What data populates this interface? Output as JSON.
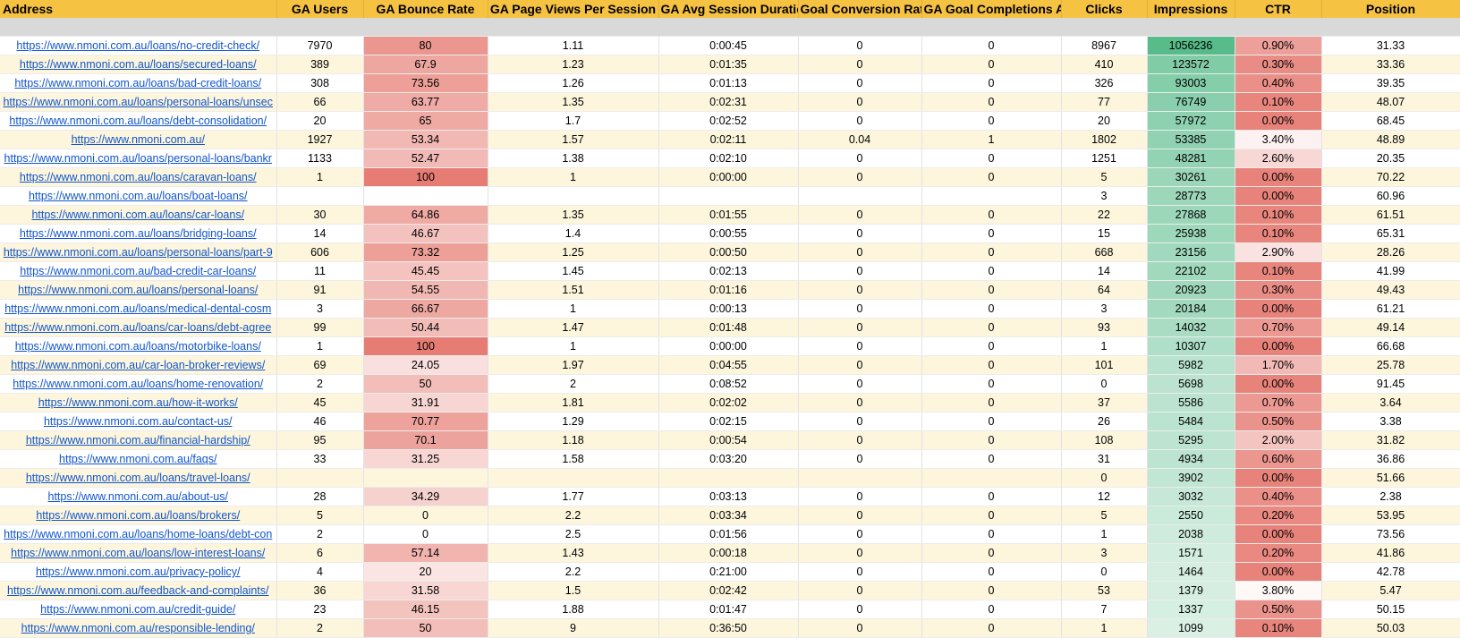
{
  "headers": [
    "Address",
    "GA Users",
    "GA Bounce Rate",
    "GA Page Views Per Session",
    "GA Avg Session Duration",
    "Goal Conversion Rate",
    "GA Goal Completions All",
    "Clicks",
    "Impressions",
    "CTR",
    "Position"
  ],
  "rows": [
    [
      "https://www.nmoni.com.au/loans/no-credit-check/",
      "7970",
      "80",
      "1.11",
      "0:00:45",
      "0",
      "0",
      "8967",
      "1056236",
      "0.90%",
      "31.33"
    ],
    [
      "https://www.nmoni.com.au/loans/secured-loans/",
      "389",
      "67.9",
      "1.23",
      "0:01:35",
      "0",
      "0",
      "410",
      "123572",
      "0.30%",
      "33.36"
    ],
    [
      "https://www.nmoni.com.au/loans/bad-credit-loans/",
      "308",
      "73.56",
      "1.26",
      "0:01:13",
      "0",
      "0",
      "326",
      "93003",
      "0.40%",
      "39.35"
    ],
    [
      "https://www.nmoni.com.au/loans/personal-loans/unsec",
      "66",
      "63.77",
      "1.35",
      "0:02:31",
      "0",
      "0",
      "77",
      "76749",
      "0.10%",
      "48.07"
    ],
    [
      "https://www.nmoni.com.au/loans/debt-consolidation/",
      "20",
      "65",
      "1.7",
      "0:02:52",
      "0",
      "0",
      "20",
      "57972",
      "0.00%",
      "68.45"
    ],
    [
      "https://www.nmoni.com.au/",
      "1927",
      "53.34",
      "1.57",
      "0:02:11",
      "0.04",
      "1",
      "1802",
      "53385",
      "3.40%",
      "48.89"
    ],
    [
      "https://www.nmoni.com.au/loans/personal-loans/bankr",
      "1133",
      "52.47",
      "1.38",
      "0:02:10",
      "0",
      "0",
      "1251",
      "48281",
      "2.60%",
      "20.35"
    ],
    [
      "https://www.nmoni.com.au/loans/caravan-loans/",
      "1",
      "100",
      "1",
      "0:00:00",
      "0",
      "0",
      "5",
      "30261",
      "0.00%",
      "70.22"
    ],
    [
      "https://www.nmoni.com.au/loans/boat-loans/",
      "",
      "",
      "",
      "",
      "",
      "",
      "3",
      "28773",
      "0.00%",
      "60.96"
    ],
    [
      "https://www.nmoni.com.au/loans/car-loans/",
      "30",
      "64.86",
      "1.35",
      "0:01:55",
      "0",
      "0",
      "22",
      "27868",
      "0.10%",
      "61.51"
    ],
    [
      "https://www.nmoni.com.au/loans/bridging-loans/",
      "14",
      "46.67",
      "1.4",
      "0:00:55",
      "0",
      "0",
      "15",
      "25938",
      "0.10%",
      "65.31"
    ],
    [
      "https://www.nmoni.com.au/loans/personal-loans/part-9",
      "606",
      "73.32",
      "1.25",
      "0:00:50",
      "0",
      "0",
      "668",
      "23156",
      "2.90%",
      "28.26"
    ],
    [
      "https://www.nmoni.com.au/bad-credit-car-loans/",
      "11",
      "45.45",
      "1.45",
      "0:02:13",
      "0",
      "0",
      "14",
      "22102",
      "0.10%",
      "41.99"
    ],
    [
      "https://www.nmoni.com.au/loans/personal-loans/",
      "91",
      "54.55",
      "1.51",
      "0:01:16",
      "0",
      "0",
      "64",
      "20923",
      "0.30%",
      "49.43"
    ],
    [
      "https://www.nmoni.com.au/loans/medical-dental-cosm",
      "3",
      "66.67",
      "1",
      "0:00:13",
      "0",
      "0",
      "3",
      "20184",
      "0.00%",
      "61.21"
    ],
    [
      "https://www.nmoni.com.au/loans/car-loans/debt-agree",
      "99",
      "50.44",
      "1.47",
      "0:01:48",
      "0",
      "0",
      "93",
      "14032",
      "0.70%",
      "49.14"
    ],
    [
      "https://www.nmoni.com.au/loans/motorbike-loans/",
      "1",
      "100",
      "1",
      "0:00:00",
      "0",
      "0",
      "1",
      "10307",
      "0.00%",
      "66.68"
    ],
    [
      "https://www.nmoni.com.au/car-loan-broker-reviews/",
      "69",
      "24.05",
      "1.97",
      "0:04:55",
      "0",
      "0",
      "101",
      "5982",
      "1.70%",
      "25.78"
    ],
    [
      "https://www.nmoni.com.au/loans/home-renovation/",
      "2",
      "50",
      "2",
      "0:08:52",
      "0",
      "0",
      "0",
      "5698",
      "0.00%",
      "91.45"
    ],
    [
      "https://www.nmoni.com.au/how-it-works/",
      "45",
      "31.91",
      "1.81",
      "0:02:02",
      "0",
      "0",
      "37",
      "5586",
      "0.70%",
      "3.64"
    ],
    [
      "https://www.nmoni.com.au/contact-us/",
      "46",
      "70.77",
      "1.29",
      "0:02:15",
      "0",
      "0",
      "26",
      "5484",
      "0.50%",
      "3.38"
    ],
    [
      "https://www.nmoni.com.au/financial-hardship/",
      "95",
      "70.1",
      "1.18",
      "0:00:54",
      "0",
      "0",
      "108",
      "5295",
      "2.00%",
      "31.82"
    ],
    [
      "https://www.nmoni.com.au/faqs/",
      "33",
      "31.25",
      "1.58",
      "0:03:20",
      "0",
      "0",
      "31",
      "4934",
      "0.60%",
      "36.86"
    ],
    [
      "https://www.nmoni.com.au/loans/travel-loans/",
      "",
      "",
      "",
      "",
      "",
      "",
      "0",
      "3902",
      "0.00%",
      "51.66"
    ],
    [
      "https://www.nmoni.com.au/about-us/",
      "28",
      "34.29",
      "1.77",
      "0:03:13",
      "0",
      "0",
      "12",
      "3032",
      "0.40%",
      "2.38"
    ],
    [
      "https://www.nmoni.com.au/loans/brokers/",
      "5",
      "0",
      "2.2",
      "0:03:34",
      "0",
      "0",
      "5",
      "2550",
      "0.20%",
      "53.95"
    ],
    [
      "https://www.nmoni.com.au/loans/home-loans/debt-con",
      "2",
      "0",
      "2.5",
      "0:01:56",
      "0",
      "0",
      "1",
      "2038",
      "0.00%",
      "73.56"
    ],
    [
      "https://www.nmoni.com.au/loans/low-interest-loans/",
      "6",
      "57.14",
      "1.43",
      "0:00:18",
      "0",
      "0",
      "3",
      "1571",
      "0.20%",
      "41.86"
    ],
    [
      "https://www.nmoni.com.au/privacy-policy/",
      "4",
      "20",
      "2.2",
      "0:21:00",
      "0",
      "0",
      "0",
      "1464",
      "0.00%",
      "42.78"
    ],
    [
      "https://www.nmoni.com.au/feedback-and-complaints/",
      "36",
      "31.58",
      "1.5",
      "0:02:42",
      "0",
      "0",
      "53",
      "1379",
      "3.80%",
      "5.47"
    ],
    [
      "https://www.nmoni.com.au/credit-guide/",
      "23",
      "46.15",
      "1.88",
      "0:01:47",
      "0",
      "0",
      "7",
      "1337",
      "0.50%",
      "50.15"
    ],
    [
      "https://www.nmoni.com.au/responsible-lending/",
      "2",
      "50",
      "9",
      "0:36:50",
      "0",
      "0",
      "1",
      "1099",
      "0.10%",
      "50.03"
    ]
  ],
  "colors": {
    "header_bg": "#f6c242",
    "link": "#1155cc",
    "bounce_high": "#e67c73",
    "impressions_high": "#57bb8a",
    "ctr_low": "#e67c73"
  }
}
